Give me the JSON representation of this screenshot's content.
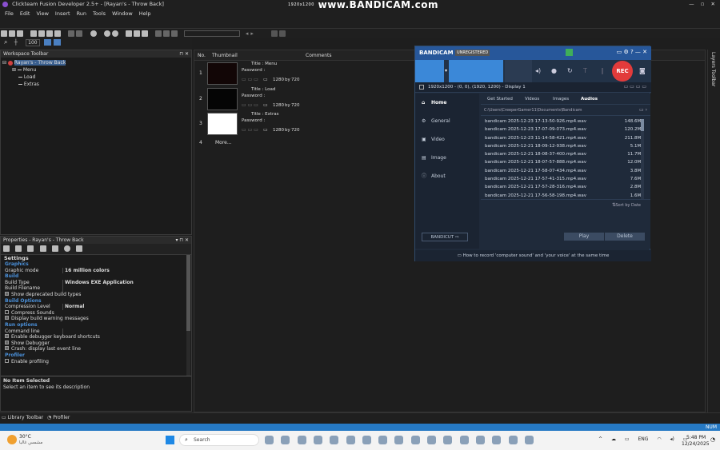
{
  "app": {
    "title": "Clickteam Fusion Developer 2.5+ - [Rayan's - Throw Back]"
  },
  "watermark": {
    "text": "www.BANDICAM.com",
    "resolution": "1920x1200"
  },
  "menu": [
    "File",
    "Edit",
    "View",
    "Insert",
    "Run",
    "Tools",
    "Window",
    "Help"
  ],
  "toolbar": {
    "zoom": "100"
  },
  "workspace": {
    "title": "Workspace Toolbar",
    "root": "Rayan's - Throw Back",
    "items": [
      "Menu",
      "Load",
      "Extras"
    ]
  },
  "properties": {
    "title": "Properties - Rayan's - Throw Back",
    "settings": "Settings",
    "rows": [
      {
        "type": "cat",
        "label": "Graphics"
      },
      {
        "type": "kv",
        "k": "Graphic mode",
        "v": "16 million colors"
      },
      {
        "type": "cat",
        "label": "Build"
      },
      {
        "type": "kv",
        "k": "Build Type",
        "v": "Windows EXE Application"
      },
      {
        "type": "kv",
        "k": "Build Filename",
        "v": ""
      },
      {
        "type": "chk",
        "k": "Show deprecated build types",
        "on": true
      },
      {
        "type": "cat",
        "label": "Build Options"
      },
      {
        "type": "kv",
        "k": "Compression Level",
        "v": "Normal"
      },
      {
        "type": "chk",
        "k": "Compress Sounds",
        "on": false
      },
      {
        "type": "chk",
        "k": "Display build warning messages",
        "on": true
      },
      {
        "type": "cat",
        "label": "Run options"
      },
      {
        "type": "kv",
        "k": "Command line",
        "v": ""
      },
      {
        "type": "chk",
        "k": "Enable debugger keyboard shortcuts",
        "on": true
      },
      {
        "type": "chk",
        "k": "Show Debugger",
        "on": true
      },
      {
        "type": "chk",
        "k": "Crash: display last event line",
        "on": true
      },
      {
        "type": "cat",
        "label": "Profiler"
      },
      {
        "type": "chk",
        "k": "Enable profiling",
        "on": false
      }
    ],
    "desc_title": "No Item Selected",
    "desc_text": "Select an item to see its description"
  },
  "storyboard": {
    "headers": [
      "No.",
      "Thumbnail",
      "Comments"
    ],
    "rows": [
      {
        "no": "1",
        "title": "Title : Menu",
        "password": "Password :",
        "w": "1280",
        "by": "by",
        "h": "720",
        "thumb": "#120606"
      },
      {
        "no": "2",
        "title": "Title : Load",
        "password": "Password :",
        "w": "1280",
        "by": "by",
        "h": "720",
        "thumb": "#050505"
      },
      {
        "no": "3",
        "title": "Title : Extras",
        "password": "Password :",
        "w": "1280",
        "by": "by",
        "h": "720",
        "thumb": "#ffffff"
      }
    ],
    "more_no": "4",
    "more": "More..."
  },
  "layers": {
    "title": "Layers Toolbar"
  },
  "bottom_tabs": [
    "Library Toolbar",
    "Profiler"
  ],
  "status": {
    "num": "NUM"
  },
  "bandicam": {
    "logo": "BANDICAM",
    "unreg": "UNREGISTERED",
    "rec": "REC",
    "display": "1920x1200 - (0, 0), (1920, 1200) - Display 1",
    "nav": [
      "Home",
      "General",
      "Video",
      "Image",
      "About"
    ],
    "tabs": [
      "Get Started",
      "Videos",
      "Images",
      "Audios"
    ],
    "path": "C:\\Users\\CreeperGamer11\\Documents\\Bandicam",
    "files": [
      {
        "name": "bandicam 2025-12-23 17-13-50-926.mp4.wav",
        "size": "148.6MB"
      },
      {
        "name": "bandicam 2025-12-23 17-07-09-073.mp4.wav",
        "size": "120.2MB"
      },
      {
        "name": "bandicam 2025-12-23 11-14-58-421.mp4.wav",
        "size": "211.8MB"
      },
      {
        "name": "bandicam 2025-12-21 18-09-12-938.mp4.wav",
        "size": "5.1MB"
      },
      {
        "name": "bandicam 2025-12-21 18-08-37-400.mp4.wav",
        "size": "11.7MB"
      },
      {
        "name": "bandicam 2025-12-21 18-07-57-888.mp4.wav",
        "size": "12.0MB"
      },
      {
        "name": "bandicam 2025-12-21 17-58-07-434.mp4.wav",
        "size": "3.8MB"
      },
      {
        "name": "bandicam 2025-12-21 17-57-41-315.mp4.wav",
        "size": "7.6MB"
      },
      {
        "name": "bandicam 2025-12-21 17-57-28-316.mp4.wav",
        "size": "2.8MB"
      },
      {
        "name": "bandicam 2025-12-21 17-56-58-198.mp4.wav",
        "size": "1.6MB"
      }
    ],
    "sort": "Sort by Date",
    "bandicut": "BANDICUT",
    "play": "Play",
    "delete": "Delete",
    "tip": "How to record 'computer sound' and 'your voice' at the same time"
  },
  "taskbar": {
    "weather_temp": "30°C",
    "weather_text": "مشمس غالبا",
    "search": "Search",
    "lang": "ENG",
    "time": "5:48 PM",
    "date": "12/24/2025"
  }
}
